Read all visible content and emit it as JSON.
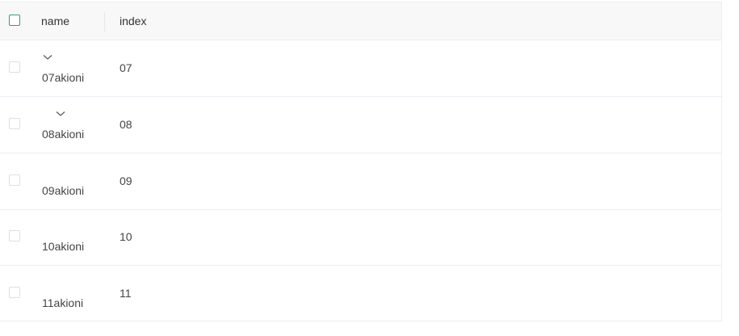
{
  "table": {
    "columns": {
      "name": "name",
      "index": "index"
    },
    "rows": [
      {
        "name": "07akioni",
        "index": "07",
        "expand_icon": "chevron-down-icon"
      },
      {
        "name": "08akioni",
        "index": "08",
        "expand_icon": "chevron-down-icon"
      },
      {
        "name": "09akioni",
        "index": "09",
        "expand_icon": null
      },
      {
        "name": "10akioni",
        "index": "10",
        "expand_icon": null
      },
      {
        "name": "11akioni",
        "index": "11",
        "expand_icon": null
      }
    ]
  },
  "colors": {
    "accent": "#2f9e7e",
    "header_bg": "#f8f8f9",
    "border": "#ebeef5"
  }
}
